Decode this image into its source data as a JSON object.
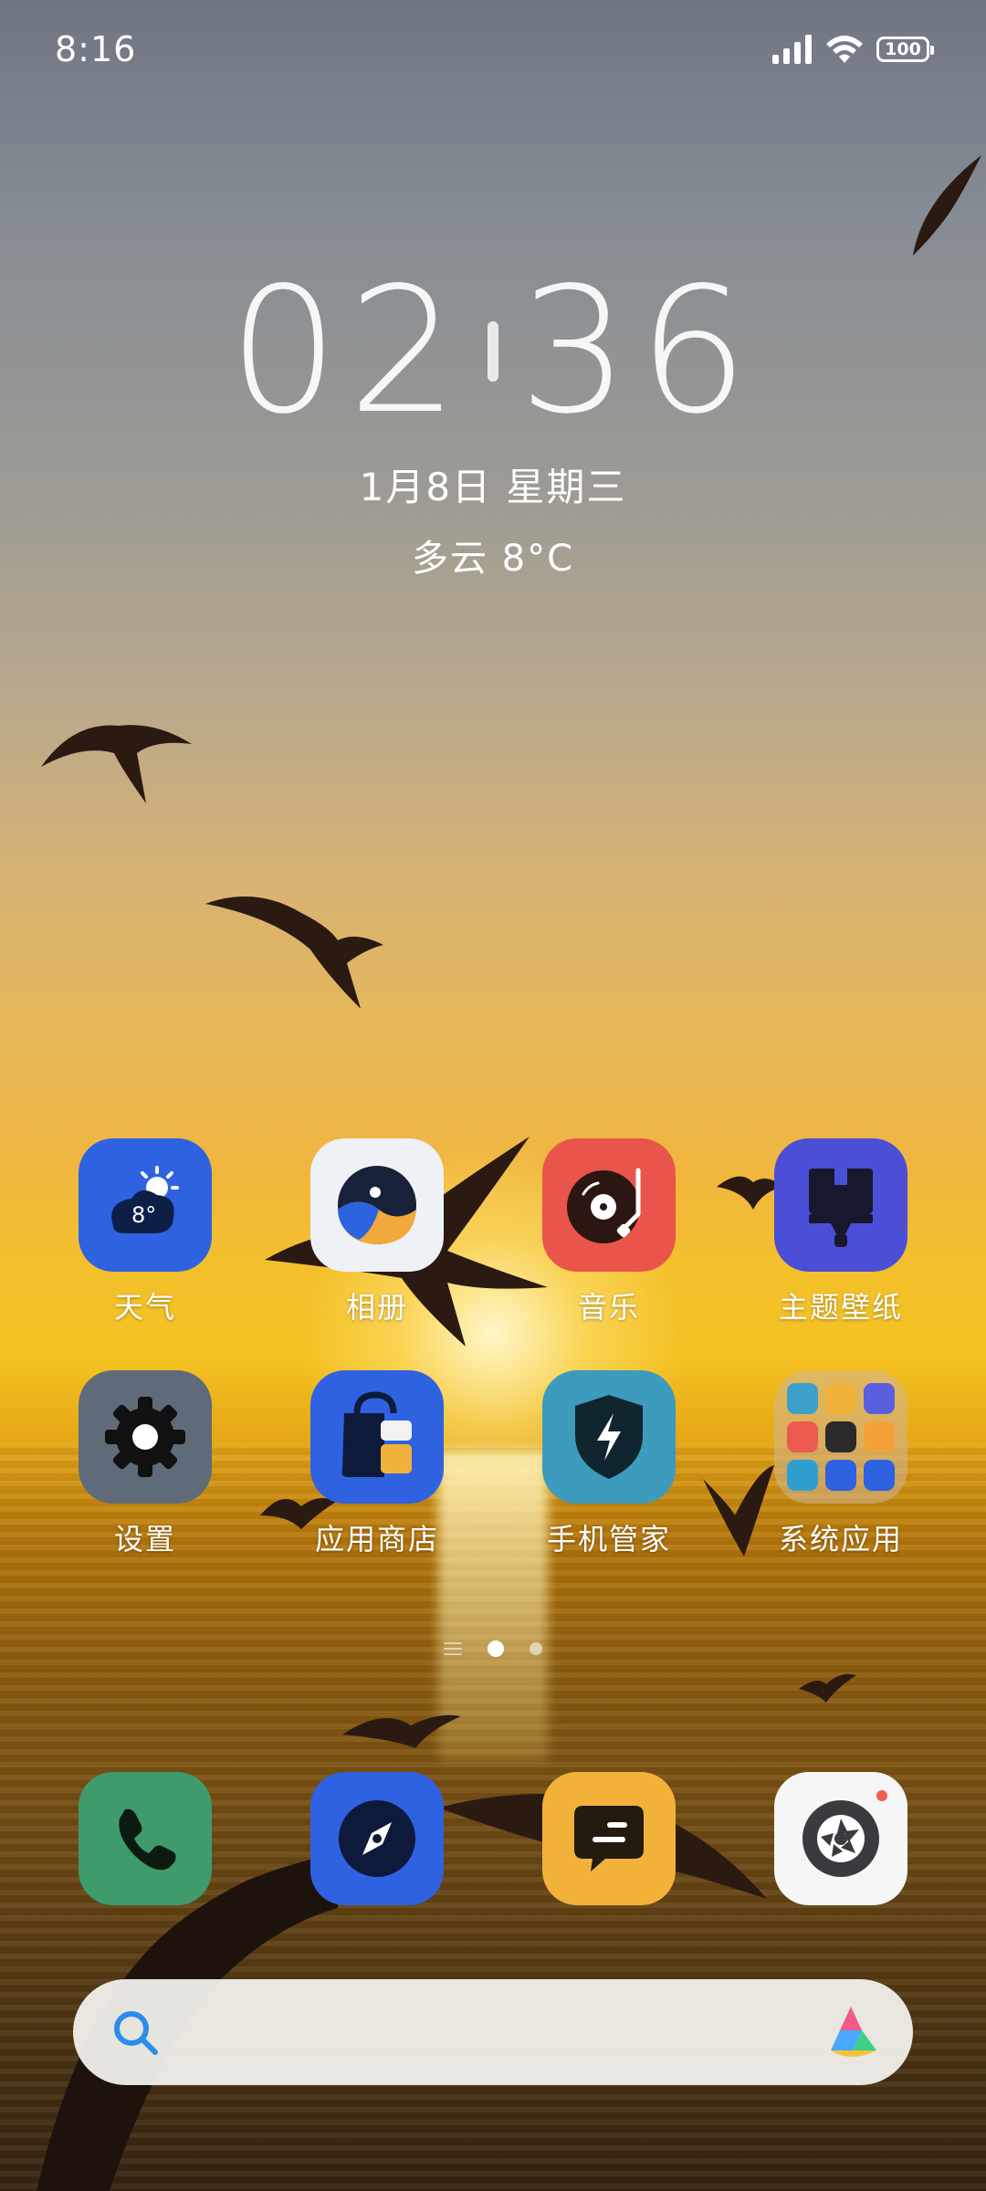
{
  "status_bar": {
    "time": "8:16",
    "battery": "100",
    "icons": [
      "signal-icon",
      "wifi-icon",
      "battery-icon"
    ]
  },
  "clock_widget": {
    "hour": "02",
    "minute": "36",
    "date": "1月8日 星期三",
    "weather": "多云 8°C"
  },
  "apps": {
    "weather": {
      "label": "天气",
      "temp": "8°",
      "color": "#2f62e0"
    },
    "gallery": {
      "label": "相册",
      "color": "#eef1f6"
    },
    "music": {
      "label": "音乐",
      "color": "#e9554a"
    },
    "themes": {
      "label": "主题壁纸",
      "color": "#4a4fd6"
    },
    "settings": {
      "label": "设置",
      "color": "#5f6b78"
    },
    "app_store": {
      "label": "应用商店",
      "color": "#2f62e0"
    },
    "security": {
      "label": "手机管家",
      "color": "#3d9bbd"
    },
    "system_apps": {
      "label": "系统应用"
    }
  },
  "page_indicator": {
    "pages": 2,
    "active": 1
  },
  "dock": [
    "phone-icon",
    "browser-icon",
    "messages-icon",
    "camera-icon"
  ],
  "search_bar": {
    "placeholder": ""
  },
  "colors": {
    "phone": "#3f9b6c",
    "browser": "#2f62e0",
    "messages": "#f2b23a",
    "camera": "#f6f6f6"
  }
}
